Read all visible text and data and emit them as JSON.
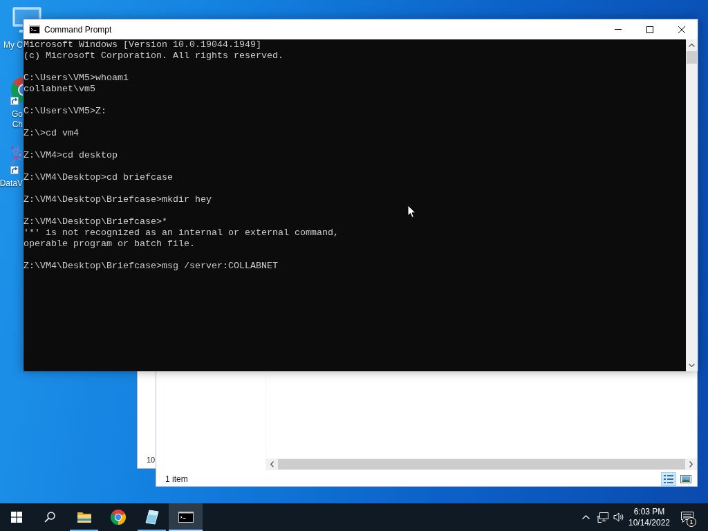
{
  "desktop": {
    "icons": [
      {
        "kind": "computer",
        "shortcut": false,
        "lines": [
          "My C"
        ]
      },
      {
        "kind": "browser",
        "shortcut": true,
        "lines": [
          "Go",
          "Ch"
        ]
      },
      {
        "kind": "chart",
        "shortcut": true,
        "lines": [
          "DataV"
        ]
      }
    ]
  },
  "command_prompt": {
    "title": "Command Prompt",
    "blocks": [
      {
        "lines": [
          "Microsoft Windows [Version 10.0.19044.1949]",
          "(c) Microsoft Corporation. All rights reserved."
        ]
      },
      {
        "lines": [
          "C:\\Users\\VM5>whoami",
          "collabnet\\vm5"
        ]
      },
      {
        "lines": [
          "C:\\Users\\VM5>Z:"
        ]
      },
      {
        "lines": [
          "Z:\\>cd vm4"
        ]
      },
      {
        "lines": [
          "Z:\\VM4>cd desktop"
        ]
      },
      {
        "lines": [
          "Z:\\VM4\\Desktop>cd briefcase"
        ]
      },
      {
        "lines": [
          "Z:\\VM4\\Desktop\\Briefcase>mkdir hey"
        ]
      },
      {
        "lines": [
          "Z:\\VM4\\Desktop\\Briefcase>*",
          "'*' is not recognized as an internal or external command,",
          "operable program or batch file."
        ]
      },
      {
        "lines": [
          "Z:\\VM4\\Desktop\\Briefcase>msg /server:COLLABNET"
        ]
      }
    ]
  },
  "background_window": {
    "text": "10"
  },
  "explorer_window": {
    "status_bar": "1 item",
    "view_buttons": [
      {
        "kind": "details",
        "selected": true
      },
      {
        "kind": "large_icons",
        "selected": false
      }
    ]
  },
  "taskbar": {
    "apps": [
      {
        "kind": "folder",
        "open": true,
        "selected": false
      },
      {
        "kind": "browser",
        "open": false,
        "selected": false
      },
      {
        "kind": "tile",
        "open": true,
        "selected": false
      },
      {
        "kind": "terminal",
        "open": true,
        "selected": true
      }
    ],
    "clock": {
      "time": "6:03 PM",
      "date": "10/14/2022"
    },
    "notifications": {
      "count": "1"
    }
  }
}
